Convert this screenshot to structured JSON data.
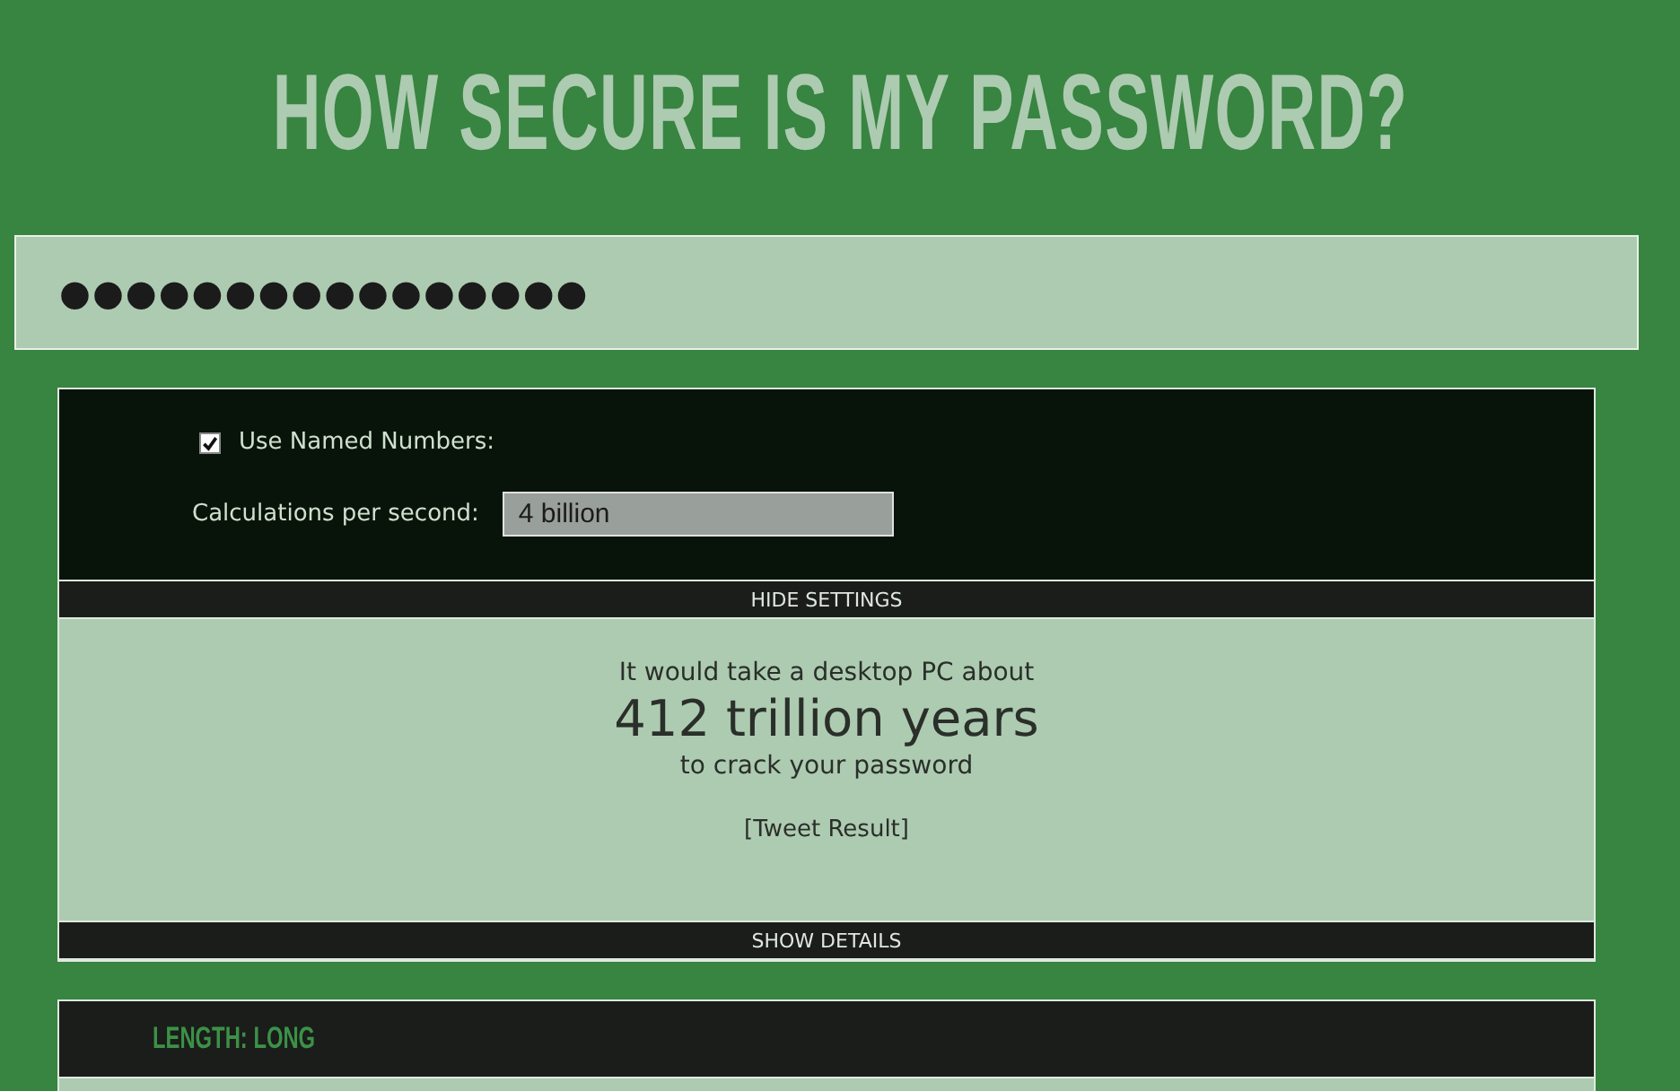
{
  "title": "HOW SECURE IS MY PASSWORD?",
  "password_field": {
    "value": "●●●●●●●●●●●●●●●●"
  },
  "settings": {
    "named_numbers": {
      "label": "Use Named Numbers:",
      "checked": true
    },
    "calculations": {
      "label": "Calculations per second:",
      "value": "4 billion"
    },
    "toggle": "HIDE SETTINGS"
  },
  "result": {
    "intro": "It would take a desktop PC about",
    "time": "412 trillion years",
    "outro": "to crack your password",
    "tweet": "[Tweet Result]",
    "toggle": "SHOW DETAILS"
  },
  "checks": [
    {
      "label": "LENGTH: LONG"
    }
  ]
}
